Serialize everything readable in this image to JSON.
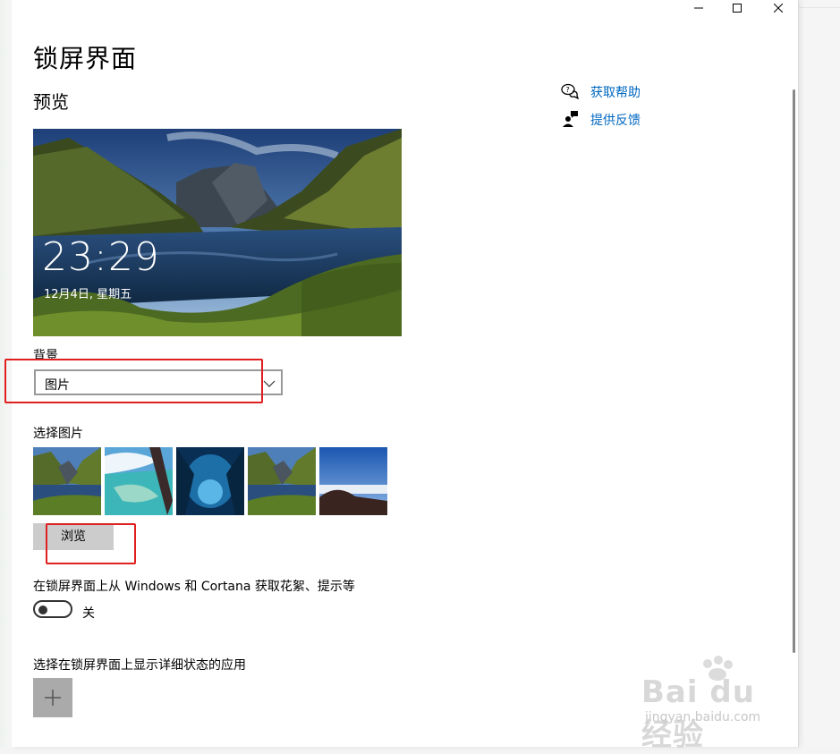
{
  "window": {
    "controls": [
      "minimize-icon",
      "maximize-icon",
      "close-icon"
    ]
  },
  "page": {
    "title": "锁屏界面",
    "preview_label": "预览"
  },
  "preview": {
    "time": "23:29",
    "date": "12月4日, 星期五"
  },
  "background": {
    "label": "背景",
    "selected": "图片"
  },
  "choose_picture": {
    "label": "选择图片",
    "thumbnails": [
      "mountain-lake",
      "tropical-coast",
      "ice-cave",
      "mountain-lake",
      "mountain-sunset"
    ],
    "browse_label": "浏览"
  },
  "tips": {
    "label": "在锁屏界面上从 Windows 和 Cortana 获取花絮、提示等",
    "toggle_label": "关",
    "toggle_on": false
  },
  "apps": {
    "label": "选择在锁屏界面上显示详细状态的应用"
  },
  "links": {
    "help": "获取帮助",
    "feedback": "提供反馈"
  },
  "watermark": {
    "logo": "Bai du 经验",
    "url": "jingyan.baidu.com"
  },
  "colors": {
    "link": "#0067c0",
    "annotation": "#e02020",
    "button": "#cccccc"
  }
}
